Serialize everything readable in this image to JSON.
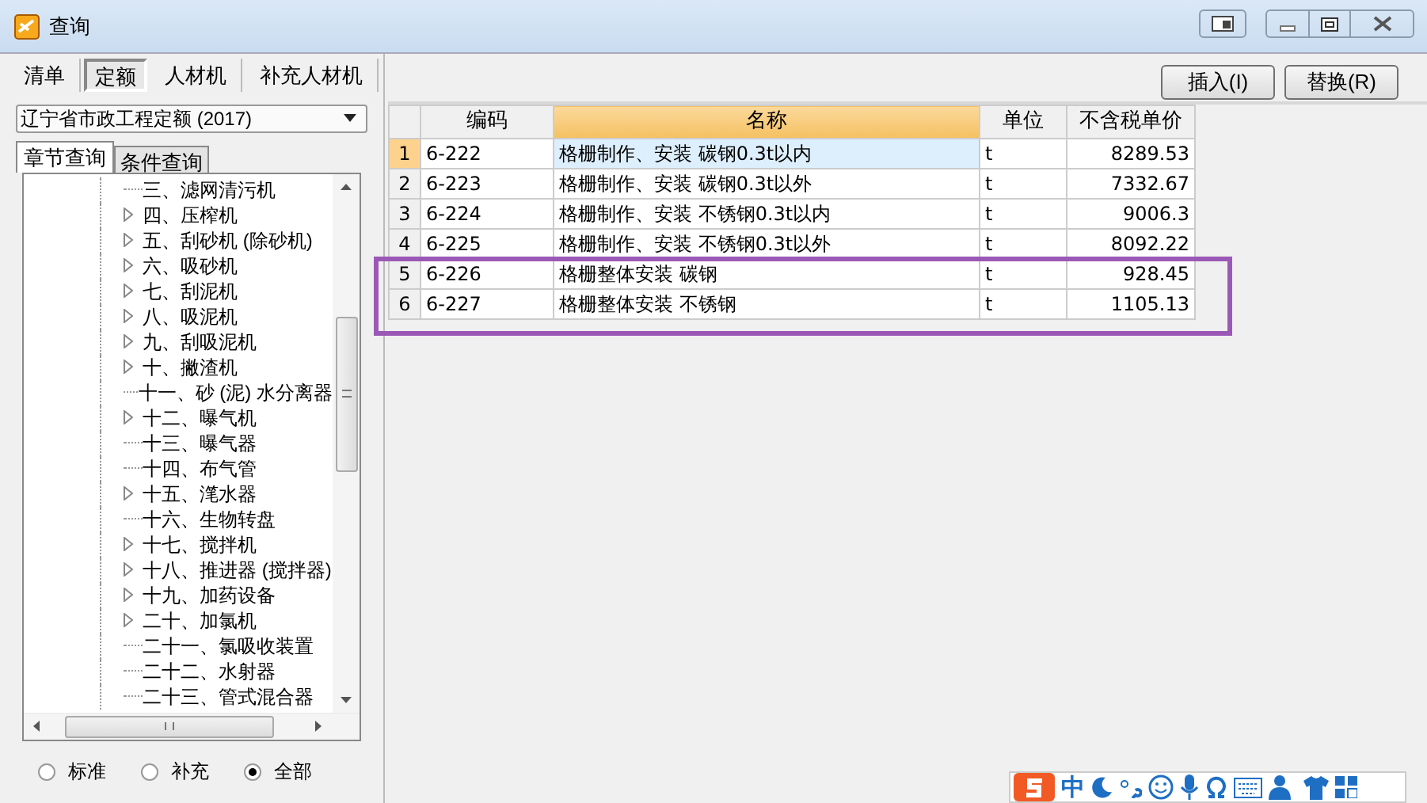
{
  "window": {
    "title": "查询"
  },
  "tabs": [
    {
      "label": "清单",
      "selected": false
    },
    {
      "label": "定额",
      "selected": true
    },
    {
      "label": "人材机",
      "selected": false
    },
    {
      "label": "补充人材机",
      "selected": false
    }
  ],
  "buttons": [
    "插入(I)",
    "替换(R)"
  ],
  "library": {
    "value": "辽宁省市政工程定额 (2017)"
  },
  "query_tabs": [
    {
      "label": "章节查询",
      "selected": true
    },
    {
      "label": "条件查询",
      "selected": false
    }
  ],
  "tree": [
    {
      "label": "三、滤网清污机",
      "expandable": false
    },
    {
      "label": "四、压榨机",
      "expandable": true
    },
    {
      "label": "五、刮砂机 (除砂机)",
      "expandable": true
    },
    {
      "label": "六、吸砂机",
      "expandable": true
    },
    {
      "label": "七、刮泥机",
      "expandable": true
    },
    {
      "label": "八、吸泥机",
      "expandable": true
    },
    {
      "label": "九、刮吸泥机",
      "expandable": true
    },
    {
      "label": "十、撇渣机",
      "expandable": true
    },
    {
      "label": "十一、砂 (泥) 水分离器",
      "expandable": false
    },
    {
      "label": "十二、曝气机",
      "expandable": true
    },
    {
      "label": "十三、曝气器",
      "expandable": false
    },
    {
      "label": "十四、布气管",
      "expandable": false
    },
    {
      "label": "十五、滗水器",
      "expandable": true
    },
    {
      "label": "十六、生物转盘",
      "expandable": false
    },
    {
      "label": "十七、搅拌机",
      "expandable": true
    },
    {
      "label": "十八、推进器 (搅拌器)",
      "expandable": true
    },
    {
      "label": "十九、加药设备",
      "expandable": true
    },
    {
      "label": "二十、加氯机",
      "expandable": true
    },
    {
      "label": "二十一、氯吸收装置",
      "expandable": false
    },
    {
      "label": "二十二、水射器",
      "expandable": false
    },
    {
      "label": "二十三、管式混合器",
      "expandable": false
    }
  ],
  "filter": [
    {
      "label": "标准",
      "selected": false
    },
    {
      "label": "补充",
      "selected": false
    },
    {
      "label": "全部",
      "selected": true
    }
  ],
  "table": {
    "columns": [
      "编码",
      "名称",
      "单位",
      "不含税单价"
    ],
    "rows": [
      {
        "index": "1",
        "cells": [
          "6-222",
          "格栅制作、安装 碳钢0.3t以内",
          "t",
          "8289.53"
        ],
        "selected": true
      },
      {
        "index": "2",
        "cells": [
          "6-223",
          "格栅制作、安装 碳钢0.3t以外",
          "t",
          "7332.67"
        ],
        "selected": false
      },
      {
        "index": "3",
        "cells": [
          "6-224",
          "格栅制作、安装 不锈钢0.3t以内",
          "t",
          "9006.3"
        ],
        "selected": false
      },
      {
        "index": "4",
        "cells": [
          "6-225",
          "格栅制作、安装 不锈钢0.3t以外",
          "t",
          "8092.22"
        ],
        "selected": false
      },
      {
        "index": "5",
        "cells": [
          "6-226",
          "格栅整体安装 碳钢",
          "t",
          "928.45"
        ],
        "selected": false
      },
      {
        "index": "6",
        "cells": [
          "6-227",
          "格栅整体安装 不锈钢",
          "t",
          "1105.13"
        ],
        "selected": false
      }
    ]
  },
  "ime_toolbar": {
    "mode": "中"
  }
}
